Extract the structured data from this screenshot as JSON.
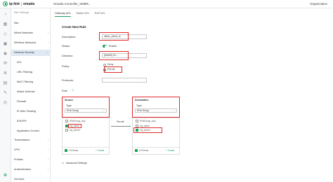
{
  "header": {
    "brand_tplink": "tp-link",
    "brand_omada": "omada",
    "controller_title": "Omada Controller_SMBR...",
    "organization": "Organization"
  },
  "sidebar": {
    "items": [
      {
        "label": "Site Settings"
      },
      {
        "label": "Site"
      },
      {
        "label": "Wired Networks"
      },
      {
        "label": "Wireless Networks"
      },
      {
        "label": "Network Security"
      },
      {
        "label": "ACL"
      },
      {
        "label": "URL Filtering"
      },
      {
        "label": "MAC Filtering"
      },
      {
        "label": "Attack Defense"
      },
      {
        "label": "Firewall"
      },
      {
        "label": "IP-MAC Binding"
      },
      {
        "label": "IDS/IPS"
      },
      {
        "label": "Application Control"
      },
      {
        "label": "Transmission"
      },
      {
        "label": "VPN"
      },
      {
        "label": "Profiles"
      },
      {
        "label": "Authentication"
      },
      {
        "label": "Services"
      }
    ]
  },
  "tabs": [
    {
      "label": "Gateway ACL"
    },
    {
      "label": "Switch ACL"
    },
    {
      "label": "EAP ACL"
    }
  ],
  "form": {
    "section_title": "Create New Rule",
    "description_label": "Description:",
    "description_value": "allow_client_to",
    "status_label": "Status:",
    "status_value": "Enable",
    "direction_label": "Direction:",
    "direction_value": "[WAN2] IN ...",
    "policy_label": "Policy:",
    "policy_deny": "Deny",
    "policy_permit": "Permit",
    "protocols_label": "Protocols:",
    "rule_label": "Rule",
    "source": {
      "title": "Source",
      "type_label": "Type",
      "type_value": "IPv6 Group",
      "items": [
        "IPv6Group_Any",
        "my_client",
        "my_server"
      ],
      "count": "1/3 Items",
      "create": "+ Create"
    },
    "permit_label": "Permit",
    "destination": {
      "title": "Destination",
      "type_label": "Type",
      "type_value": "IPv6 Group",
      "items": [
        "IPv6Group_Any",
        "my_client",
        "my_server"
      ],
      "count": "1/3 Items",
      "create": "+ Create"
    },
    "advanced_settings": "Advanced Settings"
  },
  "colors": {
    "accent": "#1aa25d",
    "highlight": "#e02a2a",
    "sidebar_active": "#dfe9f3"
  }
}
